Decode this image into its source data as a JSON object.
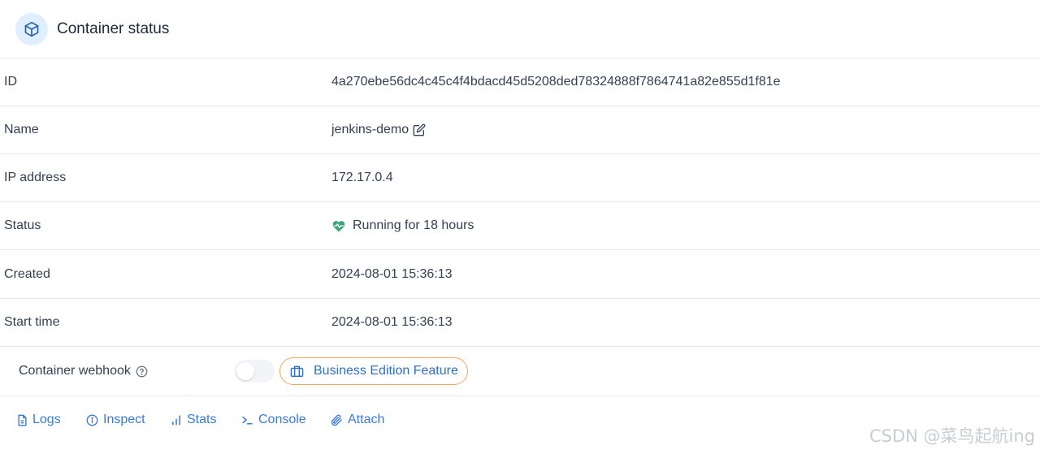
{
  "header": {
    "title": "Container status",
    "icon": "cube-icon"
  },
  "rows": [
    {
      "label": "ID",
      "value": "4a270ebe56dc4c45c4f4bdacd45d5208ded78324888f7864741a82e855d1f81e"
    },
    {
      "label": "Name",
      "value": "jenkins-demo"
    },
    {
      "label": "IP address",
      "value": "172.17.0.4"
    },
    {
      "label": "Status",
      "value": "Running for 18 hours"
    },
    {
      "label": "Created",
      "value": "2024-08-01 15:36:13"
    },
    {
      "label": "Start time",
      "value": "2024-08-01 15:36:13"
    }
  ],
  "webhook": {
    "label": "Container webhook",
    "toggle_on": false,
    "badge_label": "Business Edition Feature"
  },
  "tabs": [
    {
      "label": "Logs",
      "icon": "file-icon"
    },
    {
      "label": "Inspect",
      "icon": "info-icon"
    },
    {
      "label": "Stats",
      "icon": "bar-chart-icon"
    },
    {
      "label": "Console",
      "icon": "terminal-icon"
    },
    {
      "label": "Attach",
      "icon": "paperclip-icon"
    }
  ],
  "watermark": "CSDN @菜鸟起航ing",
  "colors": {
    "accent": "#3a7bd5",
    "status_ok": "#3aa776",
    "badge_border": "#f5a65b"
  }
}
